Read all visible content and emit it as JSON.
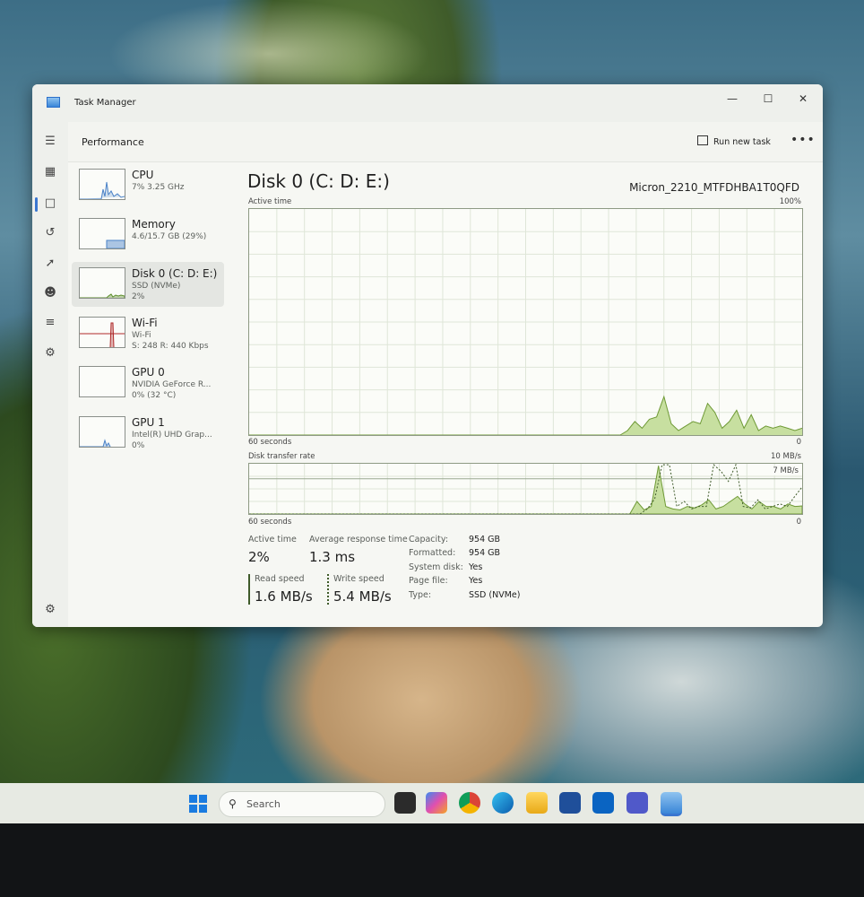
{
  "window": {
    "title": "Task Manager"
  },
  "nav": {
    "items": [
      "menu-icon",
      "processes-icon",
      "performance-icon",
      "app-history-icon",
      "startup-apps-icon",
      "users-icon",
      "details-icon",
      "services-icon",
      "settings-icon"
    ]
  },
  "header": {
    "page_title": "Performance",
    "run_new_task": "Run new task",
    "more": "•••"
  },
  "devices": [
    {
      "name": "CPU",
      "line1": "7% 3.25 GHz",
      "line2": "",
      "color": "#4a82c8"
    },
    {
      "name": "Memory",
      "line1": "4.6/15.7 GB (29%)",
      "line2": "",
      "color": "#4a82c8"
    },
    {
      "name": "Disk 0 (C: D: E:)",
      "line1": "SSD (NVMe)",
      "line2": "2%",
      "color": "#5f8f2e"
    },
    {
      "name": "Wi-Fi",
      "line1": "Wi-Fi",
      "line2": "S: 248 R: 440 Kbps",
      "color": "#b02a2a"
    },
    {
      "name": "GPU 0",
      "line1": "NVIDIA GeForce R...",
      "line2": "0% (32 °C)",
      "color": "#4a82c8"
    },
    {
      "name": "GPU 1",
      "line1": "Intel(R) UHD Grap...",
      "line2": "0%",
      "color": "#4a82c8"
    }
  ],
  "main": {
    "title": "Disk 0 (C: D: E:)",
    "model": "Micron_2210_MTFDHBA1T0QFD",
    "active_chart": {
      "label": "Active time",
      "max": "100%",
      "x_left": "60 seconds",
      "x_right": "0"
    },
    "transfer_chart": {
      "label": "Disk transfer rate",
      "max": "10 MB/s",
      "ref_line": "7 MB/s",
      "x_left": "60 seconds",
      "x_right": "0"
    },
    "stats": {
      "active_time_label": "Active time",
      "active_time": "2%",
      "avg_response_label": "Average response time",
      "avg_response": "1.3 ms",
      "read_label": "Read speed",
      "read": "1.6 MB/s",
      "write_label": "Write speed",
      "write": "5.4 MB/s"
    },
    "properties": [
      {
        "label": "Capacity:",
        "value": "954 GB"
      },
      {
        "label": "Formatted:",
        "value": "954 GB"
      },
      {
        "label": "System disk:",
        "value": "Yes"
      },
      {
        "label": "Page file:",
        "value": "Yes"
      },
      {
        "label": "Type:",
        "value": "SSD (NVMe)"
      }
    ]
  },
  "chart_data": [
    {
      "type": "area",
      "title": "Active time",
      "ylim": [
        0,
        100
      ],
      "unit": "%",
      "x": [
        60,
        59,
        58,
        57,
        56,
        55,
        54,
        53,
        52,
        51,
        50,
        49,
        48,
        47,
        46,
        45,
        44,
        43,
        42,
        41,
        40,
        39,
        38,
        37,
        36,
        35,
        34,
        33,
        32,
        31,
        30,
        29,
        28,
        27,
        26,
        25,
        24,
        23,
        22,
        21,
        20,
        19,
        18,
        17,
        16,
        15,
        14,
        13,
        12,
        11,
        10,
        9,
        8,
        7,
        6,
        5,
        4,
        3,
        2,
        1,
        0
      ],
      "values": [
        0,
        0,
        0,
        0,
        0,
        0,
        0,
        0,
        0,
        0,
        0,
        0,
        0,
        0,
        0,
        0,
        0,
        0,
        0,
        0,
        0,
        0,
        0,
        0,
        0,
        0,
        0,
        0,
        0,
        0,
        0,
        0,
        0,
        0,
        0,
        0,
        0,
        0,
        0,
        0,
        0,
        0,
        0,
        0,
        0,
        0,
        0,
        0,
        0,
        0,
        0,
        0,
        2,
        6,
        3,
        7,
        8,
        17,
        5,
        2,
        4,
        6,
        5,
        14,
        10,
        3,
        6,
        11,
        3,
        9,
        2,
        4,
        3,
        4,
        3,
        2,
        3
      ]
    },
    {
      "type": "area",
      "title": "Disk transfer rate",
      "ylim": [
        0,
        10
      ],
      "unit": "MB/s",
      "series": [
        {
          "name": "Read speed",
          "values": [
            0,
            0,
            0,
            0,
            0,
            0,
            0,
            0,
            0,
            0,
            0,
            0,
            0,
            0,
            0,
            0,
            0,
            0,
            0,
            0,
            0,
            0,
            0,
            0,
            0,
            0,
            0,
            0,
            0,
            0,
            0,
            0,
            0,
            0,
            0,
            0,
            0,
            0,
            0,
            0,
            0,
            0,
            0,
            0,
            0,
            0,
            0,
            0,
            0,
            0,
            0,
            0,
            0,
            0,
            2.5,
            0.8,
            1.5,
            9.6,
            1.5,
            1,
            0.8,
            1.5,
            1.2,
            1.8,
            2.8,
            1,
            1.5,
            2.5,
            3.5,
            2,
            1,
            2.5,
            1.5,
            1.5,
            1,
            2,
            1.5,
            1.6
          ]
        },
        {
          "name": "Write speed",
          "values": [
            0,
            0,
            0,
            0,
            0,
            0,
            0,
            0,
            0,
            0,
            0,
            0,
            0,
            0,
            0,
            0,
            0,
            0,
            0,
            0,
            0,
            0,
            0,
            0,
            0,
            0,
            0,
            0,
            0,
            0,
            0,
            0,
            0,
            0,
            0,
            0,
            0,
            0,
            0,
            0,
            0,
            0,
            0,
            0,
            0,
            0,
            0,
            0,
            0,
            0,
            0,
            0,
            0,
            0,
            1,
            3,
            9.8,
            9.8,
            1.5,
            2.5,
            1,
            1.5,
            1.5,
            9.8,
            8.5,
            6.5,
            9.8,
            1.5,
            1.2,
            2.8,
            1,
            1.5,
            2,
            1.5,
            3.5,
            5.4
          ]
        }
      ]
    }
  ],
  "taskbar": {
    "search_placeholder": "Search",
    "apps": [
      "task-view-icon",
      "copilot-icon",
      "chrome-icon",
      "edge-icon",
      "file-explorer-icon",
      "store-icon",
      "outlook-icon",
      "teams-icon",
      "task-manager-icon"
    ]
  }
}
